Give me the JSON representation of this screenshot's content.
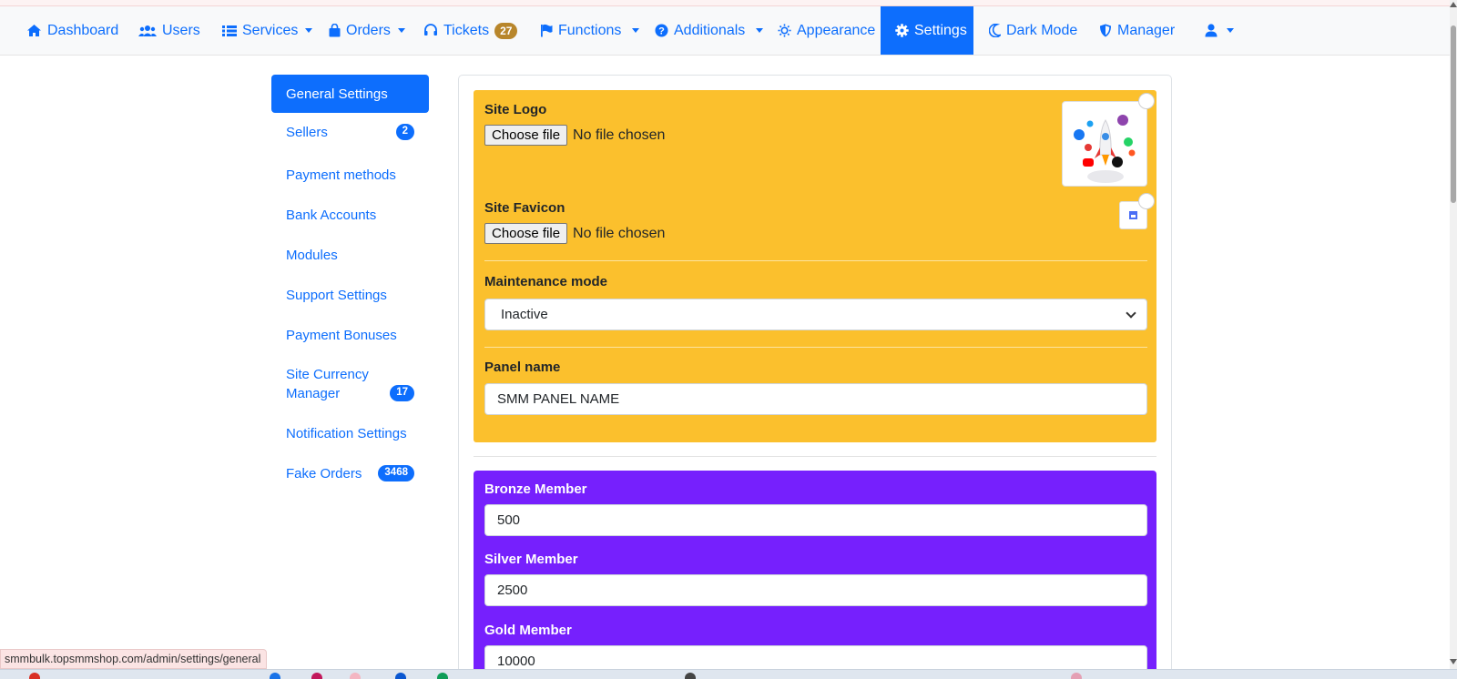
{
  "nav": {
    "dashboard": "Dashboard",
    "users": "Users",
    "services": "Services",
    "orders": "Orders",
    "tickets": "Tickets",
    "tickets_count": "27",
    "functions": "Functions",
    "additionals": "Additionals",
    "appearance": "Appearance",
    "settings": "Settings",
    "dark_mode": "Dark Mode",
    "manager": "Manager"
  },
  "sidebar": {
    "items": [
      {
        "label": "General Settings",
        "badge": "",
        "active": true
      },
      {
        "label": "Sellers",
        "badge": "2"
      },
      {
        "label": "Payment methods",
        "badge": ""
      },
      {
        "label": "Bank Accounts",
        "badge": ""
      },
      {
        "label": "Modules",
        "badge": ""
      },
      {
        "label": "Support Settings",
        "badge": ""
      },
      {
        "label": "Payment Bonuses",
        "badge": ""
      },
      {
        "label": "Site Currency Manager",
        "badge": "17"
      },
      {
        "label": "Notification Settings",
        "badge": ""
      },
      {
        "label": "Fake Orders",
        "badge": "3468"
      }
    ]
  },
  "form": {
    "site_logo_label": "Site Logo",
    "choose_file": "Choose file",
    "no_file": "No file chosen",
    "site_favicon_label": "Site Favicon",
    "maintenance_label": "Maintenance mode",
    "maintenance_value": "Inactive",
    "panel_name_label": "Panel name",
    "panel_name_value": "SMM PANEL NAME",
    "bronze_label": "Bronze Member",
    "bronze_value": "500",
    "silver_label": "Silver Member",
    "silver_value": "2500",
    "gold_label": "Gold Member",
    "gold_value": "10000"
  },
  "status_url": "smmbulk.topsmmshop.com/admin/settings/general",
  "colors": {
    "primary": "#0d6efd",
    "yellow_panel": "#fbc02d",
    "purple_panel": "#7620fd",
    "tickets_badge": "#b8862b"
  }
}
